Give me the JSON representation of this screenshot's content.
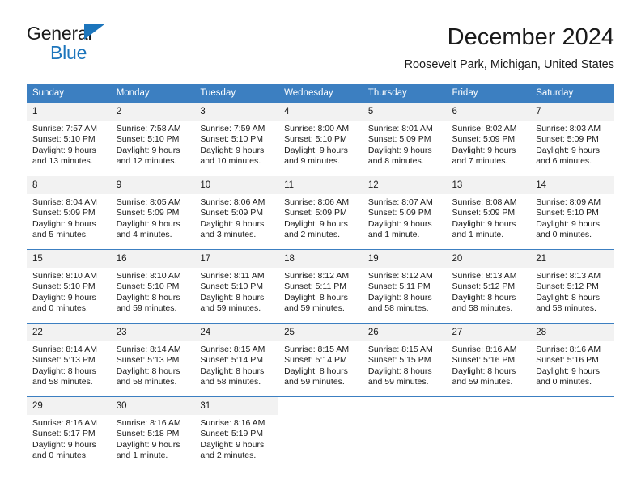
{
  "brand": {
    "name_top": "General",
    "name_bottom": "Blue",
    "accent_color": "#1c75bc"
  },
  "header": {
    "title": "December 2024",
    "location": "Roosevelt Park, Michigan, United States"
  },
  "calendar": {
    "header_bg": "#3c7fc1",
    "daynum_bg": "#f2f2f2",
    "weekday_headers": [
      "Sunday",
      "Monday",
      "Tuesday",
      "Wednesday",
      "Thursday",
      "Friday",
      "Saturday"
    ],
    "weeks": [
      [
        {
          "day": "1",
          "sunrise": "Sunrise: 7:57 AM",
          "sunset": "Sunset: 5:10 PM",
          "daylight": "Daylight: 9 hours and 13 minutes."
        },
        {
          "day": "2",
          "sunrise": "Sunrise: 7:58 AM",
          "sunset": "Sunset: 5:10 PM",
          "daylight": "Daylight: 9 hours and 12 minutes."
        },
        {
          "day": "3",
          "sunrise": "Sunrise: 7:59 AM",
          "sunset": "Sunset: 5:10 PM",
          "daylight": "Daylight: 9 hours and 10 minutes."
        },
        {
          "day": "4",
          "sunrise": "Sunrise: 8:00 AM",
          "sunset": "Sunset: 5:10 PM",
          "daylight": "Daylight: 9 hours and 9 minutes."
        },
        {
          "day": "5",
          "sunrise": "Sunrise: 8:01 AM",
          "sunset": "Sunset: 5:09 PM",
          "daylight": "Daylight: 9 hours and 8 minutes."
        },
        {
          "day": "6",
          "sunrise": "Sunrise: 8:02 AM",
          "sunset": "Sunset: 5:09 PM",
          "daylight": "Daylight: 9 hours and 7 minutes."
        },
        {
          "day": "7",
          "sunrise": "Sunrise: 8:03 AM",
          "sunset": "Sunset: 5:09 PM",
          "daylight": "Daylight: 9 hours and 6 minutes."
        }
      ],
      [
        {
          "day": "8",
          "sunrise": "Sunrise: 8:04 AM",
          "sunset": "Sunset: 5:09 PM",
          "daylight": "Daylight: 9 hours and 5 minutes."
        },
        {
          "day": "9",
          "sunrise": "Sunrise: 8:05 AM",
          "sunset": "Sunset: 5:09 PM",
          "daylight": "Daylight: 9 hours and 4 minutes."
        },
        {
          "day": "10",
          "sunrise": "Sunrise: 8:06 AM",
          "sunset": "Sunset: 5:09 PM",
          "daylight": "Daylight: 9 hours and 3 minutes."
        },
        {
          "day": "11",
          "sunrise": "Sunrise: 8:06 AM",
          "sunset": "Sunset: 5:09 PM",
          "daylight": "Daylight: 9 hours and 2 minutes."
        },
        {
          "day": "12",
          "sunrise": "Sunrise: 8:07 AM",
          "sunset": "Sunset: 5:09 PM",
          "daylight": "Daylight: 9 hours and 1 minute."
        },
        {
          "day": "13",
          "sunrise": "Sunrise: 8:08 AM",
          "sunset": "Sunset: 5:09 PM",
          "daylight": "Daylight: 9 hours and 1 minute."
        },
        {
          "day": "14",
          "sunrise": "Sunrise: 8:09 AM",
          "sunset": "Sunset: 5:10 PM",
          "daylight": "Daylight: 9 hours and 0 minutes."
        }
      ],
      [
        {
          "day": "15",
          "sunrise": "Sunrise: 8:10 AM",
          "sunset": "Sunset: 5:10 PM",
          "daylight": "Daylight: 9 hours and 0 minutes."
        },
        {
          "day": "16",
          "sunrise": "Sunrise: 8:10 AM",
          "sunset": "Sunset: 5:10 PM",
          "daylight": "Daylight: 8 hours and 59 minutes."
        },
        {
          "day": "17",
          "sunrise": "Sunrise: 8:11 AM",
          "sunset": "Sunset: 5:10 PM",
          "daylight": "Daylight: 8 hours and 59 minutes."
        },
        {
          "day": "18",
          "sunrise": "Sunrise: 8:12 AM",
          "sunset": "Sunset: 5:11 PM",
          "daylight": "Daylight: 8 hours and 59 minutes."
        },
        {
          "day": "19",
          "sunrise": "Sunrise: 8:12 AM",
          "sunset": "Sunset: 5:11 PM",
          "daylight": "Daylight: 8 hours and 58 minutes."
        },
        {
          "day": "20",
          "sunrise": "Sunrise: 8:13 AM",
          "sunset": "Sunset: 5:12 PM",
          "daylight": "Daylight: 8 hours and 58 minutes."
        },
        {
          "day": "21",
          "sunrise": "Sunrise: 8:13 AM",
          "sunset": "Sunset: 5:12 PM",
          "daylight": "Daylight: 8 hours and 58 minutes."
        }
      ],
      [
        {
          "day": "22",
          "sunrise": "Sunrise: 8:14 AM",
          "sunset": "Sunset: 5:13 PM",
          "daylight": "Daylight: 8 hours and 58 minutes."
        },
        {
          "day": "23",
          "sunrise": "Sunrise: 8:14 AM",
          "sunset": "Sunset: 5:13 PM",
          "daylight": "Daylight: 8 hours and 58 minutes."
        },
        {
          "day": "24",
          "sunrise": "Sunrise: 8:15 AM",
          "sunset": "Sunset: 5:14 PM",
          "daylight": "Daylight: 8 hours and 58 minutes."
        },
        {
          "day": "25",
          "sunrise": "Sunrise: 8:15 AM",
          "sunset": "Sunset: 5:14 PM",
          "daylight": "Daylight: 8 hours and 59 minutes."
        },
        {
          "day": "26",
          "sunrise": "Sunrise: 8:15 AM",
          "sunset": "Sunset: 5:15 PM",
          "daylight": "Daylight: 8 hours and 59 minutes."
        },
        {
          "day": "27",
          "sunrise": "Sunrise: 8:16 AM",
          "sunset": "Sunset: 5:16 PM",
          "daylight": "Daylight: 8 hours and 59 minutes."
        },
        {
          "day": "28",
          "sunrise": "Sunrise: 8:16 AM",
          "sunset": "Sunset: 5:16 PM",
          "daylight": "Daylight: 9 hours and 0 minutes."
        }
      ],
      [
        {
          "day": "29",
          "sunrise": "Sunrise: 8:16 AM",
          "sunset": "Sunset: 5:17 PM",
          "daylight": "Daylight: 9 hours and 0 minutes."
        },
        {
          "day": "30",
          "sunrise": "Sunrise: 8:16 AM",
          "sunset": "Sunset: 5:18 PM",
          "daylight": "Daylight: 9 hours and 1 minute."
        },
        {
          "day": "31",
          "sunrise": "Sunrise: 8:16 AM",
          "sunset": "Sunset: 5:19 PM",
          "daylight": "Daylight: 9 hours and 2 minutes."
        },
        {
          "day": "",
          "sunrise": "",
          "sunset": "",
          "daylight": ""
        },
        {
          "day": "",
          "sunrise": "",
          "sunset": "",
          "daylight": ""
        },
        {
          "day": "",
          "sunrise": "",
          "sunset": "",
          "daylight": ""
        },
        {
          "day": "",
          "sunrise": "",
          "sunset": "",
          "daylight": ""
        }
      ]
    ]
  }
}
